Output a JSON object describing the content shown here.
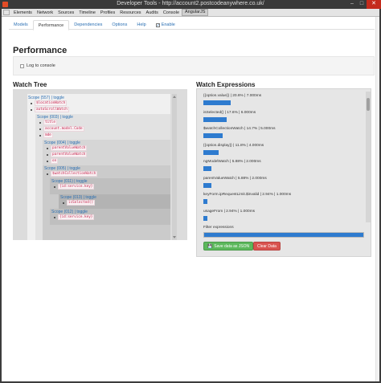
{
  "window": {
    "title": "Developer Tools - http://account2.postcodeanywhere.co.uk/",
    "minimize": "–",
    "maximize": "□",
    "close": "✕"
  },
  "devtools_tabs": [
    "Elements",
    "Network",
    "Sources",
    "Timeline",
    "Profiles",
    "Resources",
    "Audits",
    "Console",
    "AngularJS"
  ],
  "nav_tabs": [
    "Models",
    "Performance",
    "Dependencies",
    "Options",
    "Help"
  ],
  "enable_label": "Enable",
  "page_title": "Performance",
  "log_to_console": "Log to console",
  "watch_tree_title": "Watch Tree",
  "watch_expr_title": "Watch Expressions",
  "tree": {
    "scope1": "Scope (557) | toggle",
    "scope1_items": [
      "$locationWatch",
      "autoScrollWatch"
    ],
    "scope2": "Scope (003) | toggle",
    "scope2_items": [
      "title",
      "account.model.Code",
      "mde"
    ],
    "scope3": "Scope (004) | toggle",
    "scope3_items": [
      "parentValueWatch",
      "parentValueWatch",
      "on"
    ],
    "scope4": "Scope (005) | toggle",
    "scope4_items": [
      "$watchCollectionWatch"
    ],
    "scope5": "Scope (011) | toggle",
    "scope5_items": [
      "{id:service.key}"
    ],
    "scope6": "Scope (013) | toggle",
    "scope6_items": [
      "isSelected()"
    ],
    "scope7": "Scope (012) | toggle",
    "scope7_items": [
      "{id:service.key}"
    ]
  },
  "watch_expressions": [
    {
      "label": "{{option.value}} | 20.6% | 7.000ms",
      "percent": 20.6
    },
    {
      "label": "isSelected() | 17.6% | 6.000ms",
      "percent": 17.6
    },
    {
      "label": "$watchCollectionWatch | 14.7% | 5.000ms",
      "percent": 14.7
    },
    {
      "label": "{{option.display}} | 11.8% | 4.000ms",
      "percent": 11.8
    },
    {
      "label": "ngModelWatch | 5.88% | 2.000ms",
      "percent": 5.88
    },
    {
      "label": "parentValueWatch | 5.88% | 2.000ms",
      "percent": 5.88
    },
    {
      "label": "keyForm.ipRequestLimit.$invalid | 2.94% | 1.000ms",
      "percent": 2.94
    },
    {
      "label": "usageFrom | 2.94% | 1.000ms",
      "percent": 2.94
    }
  ],
  "filter_label": "Filter expressions",
  "save_button": "Save data as JSON",
  "clear_button": "Clear Data",
  "colors": {
    "bar": "#2e7bcf",
    "save": "#5cb85c",
    "clear": "#d9534f",
    "link": "#2a6fb3"
  }
}
